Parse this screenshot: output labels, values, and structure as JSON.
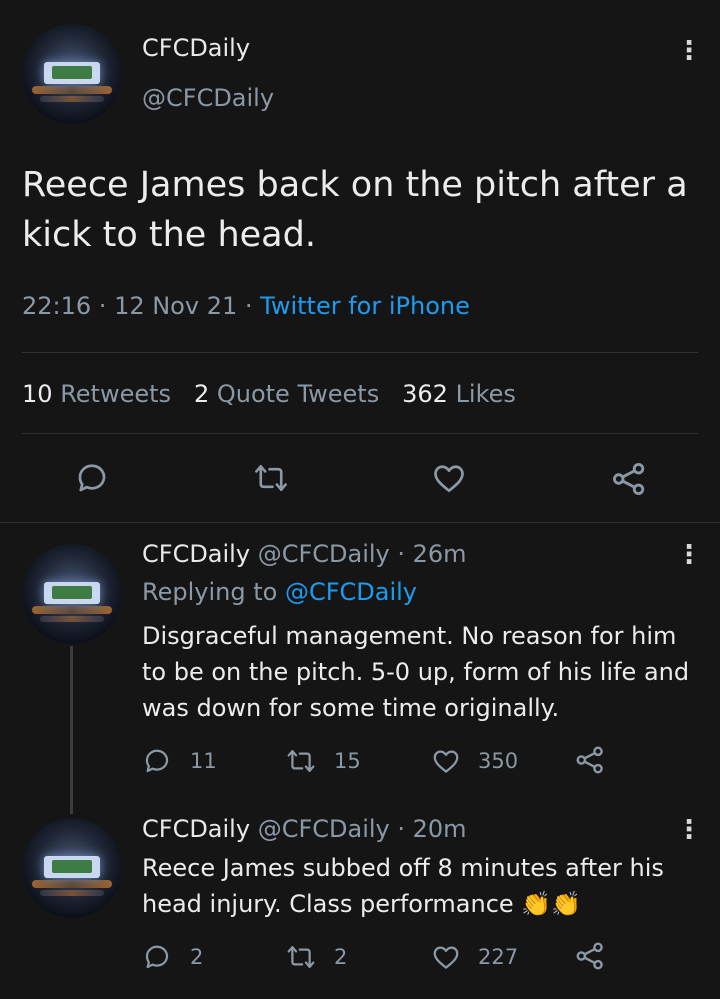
{
  "main_tweet": {
    "author_name": "CFCDaily",
    "author_handle": "@CFCDaily",
    "text": "Reece James back on the pitch after a kick to the head.",
    "time": "22:16",
    "sep1": " · ",
    "date": "12 Nov 21",
    "sep2": " · ",
    "source": "Twitter for iPhone",
    "retweets_count": "10",
    "retweets_label": "Retweets",
    "quote_count": "2",
    "quote_label": "Quote Tweets",
    "likes_count": "362",
    "likes_label": "Likes"
  },
  "replies": [
    {
      "author_name": "CFCDaily",
      "author_handle": "@CFCDaily",
      "age": "· 26m",
      "replying_label": "Replying to",
      "replying_to": "@CFCDaily",
      "text": "Disgraceful management. No reason for him to be on the pitch. 5-0 up, form of his life and was down for some time originally.",
      "reply_count": "11",
      "retweet_count": "15",
      "like_count": "350"
    },
    {
      "author_name": "CFCDaily",
      "author_handle": "@CFCDaily",
      "age": "· 20m",
      "text": "Reece James subbed off 8 minutes after his head injury. Class performance 👏👏",
      "reply_count": "2",
      "retweet_count": "2",
      "like_count": "227"
    }
  ],
  "icons": {
    "more": "more-vertical-icon",
    "reply": "speech-bubble-icon",
    "retweet": "retweet-arrows-icon",
    "like": "heart-outline-icon",
    "share": "share-nodes-icon"
  },
  "colors": {
    "background": "#151515",
    "accent_link": "#1d9bf0",
    "muted_text": "#8b98a5"
  }
}
